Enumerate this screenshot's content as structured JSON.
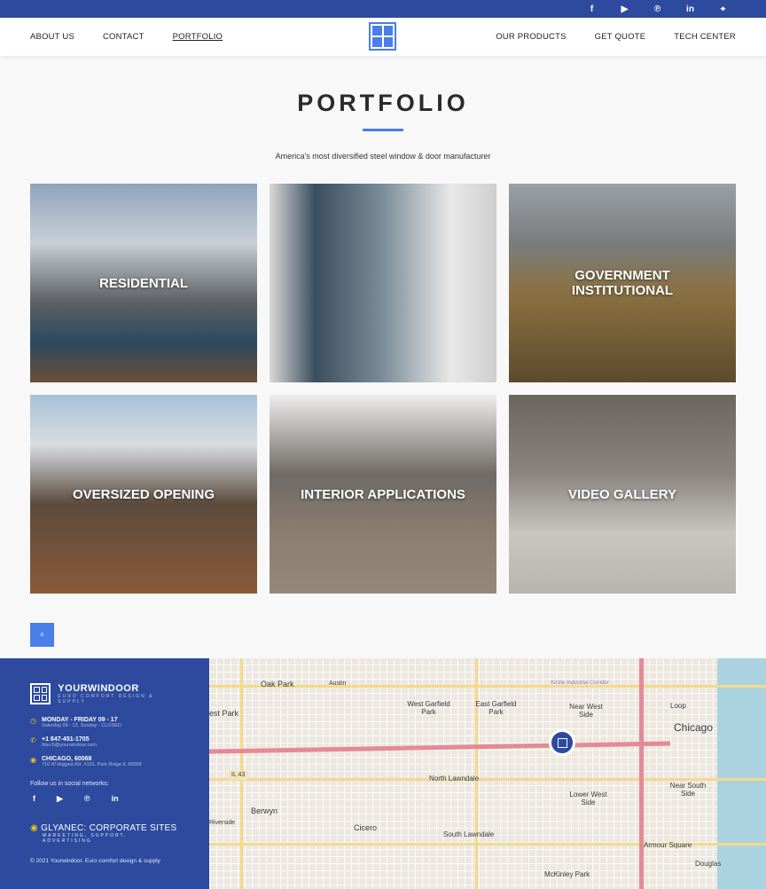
{
  "topbar": {
    "social": [
      {
        "icon": "facebook-icon",
        "glyph": "f"
      },
      {
        "icon": "youtube-icon",
        "glyph": "▶"
      },
      {
        "icon": "pinterest-icon",
        "glyph": "℗"
      },
      {
        "icon": "linkedin-icon",
        "glyph": "in"
      },
      {
        "icon": "location-icon",
        "glyph": "⬤"
      }
    ]
  },
  "nav": {
    "left": [
      "ABOUT US",
      "CONTACT",
      "PORTFOLIO"
    ],
    "right": [
      "OUR PRODUCTS",
      "GET QUOTE",
      "TECH CENTER"
    ],
    "active": "PORTFOLIO"
  },
  "page": {
    "title": "PORTFOLIO",
    "subtitle": "America's most diversified steel window & door manufacturer"
  },
  "tiles": [
    "RESIDENTIAL",
    "",
    "GOVERNMENT\nINSTITUTIONAL",
    "OVERSIZED OPENING",
    "INTERIOR APPLICATIONS",
    "VIDEO GALLERY"
  ],
  "back_to_top": "˄",
  "footer": {
    "brand": "YOURWINDOOR",
    "tagline": "EURO COMFORT DESIGN & SUPPLY",
    "hours_title": "MONDAY - FRIDAY 09 - 17",
    "hours_sub": "Saturday 09 - 13, Sunday - CLOSED",
    "phone": "+1 847-451-1705",
    "email": "hitech@yourwindoor.com",
    "city": "CHICAGO, 60068",
    "address": "710 W Higgins Rd. #101, Park Ridge IL 60068",
    "follow": "Follow us in social networks:",
    "social": [
      "f",
      "▶",
      "℗",
      "in"
    ],
    "agency": "GLYANEC: CORPORATE SITES",
    "agency_sub": "MARKETING, SUPPORT, ADVERTISING",
    "copyright": "© 2021 Yourwindoor. Euro comfort design & supply"
  },
  "map": {
    "labels": [
      "Oak Park",
      "Austin",
      "West Garfield Park",
      "East Garfield Park",
      "Near West Side",
      "Loop",
      "Chicago",
      "est Park",
      "North Lawndale",
      "IL 43",
      "Lower West Side",
      "Near South Side",
      "Berwyn",
      "Riverside",
      "Cicero",
      "South Lawndale",
      "Armour Square",
      "Douglas",
      "McKinley Park",
      "Kinzie Industrial Corridor"
    ]
  }
}
